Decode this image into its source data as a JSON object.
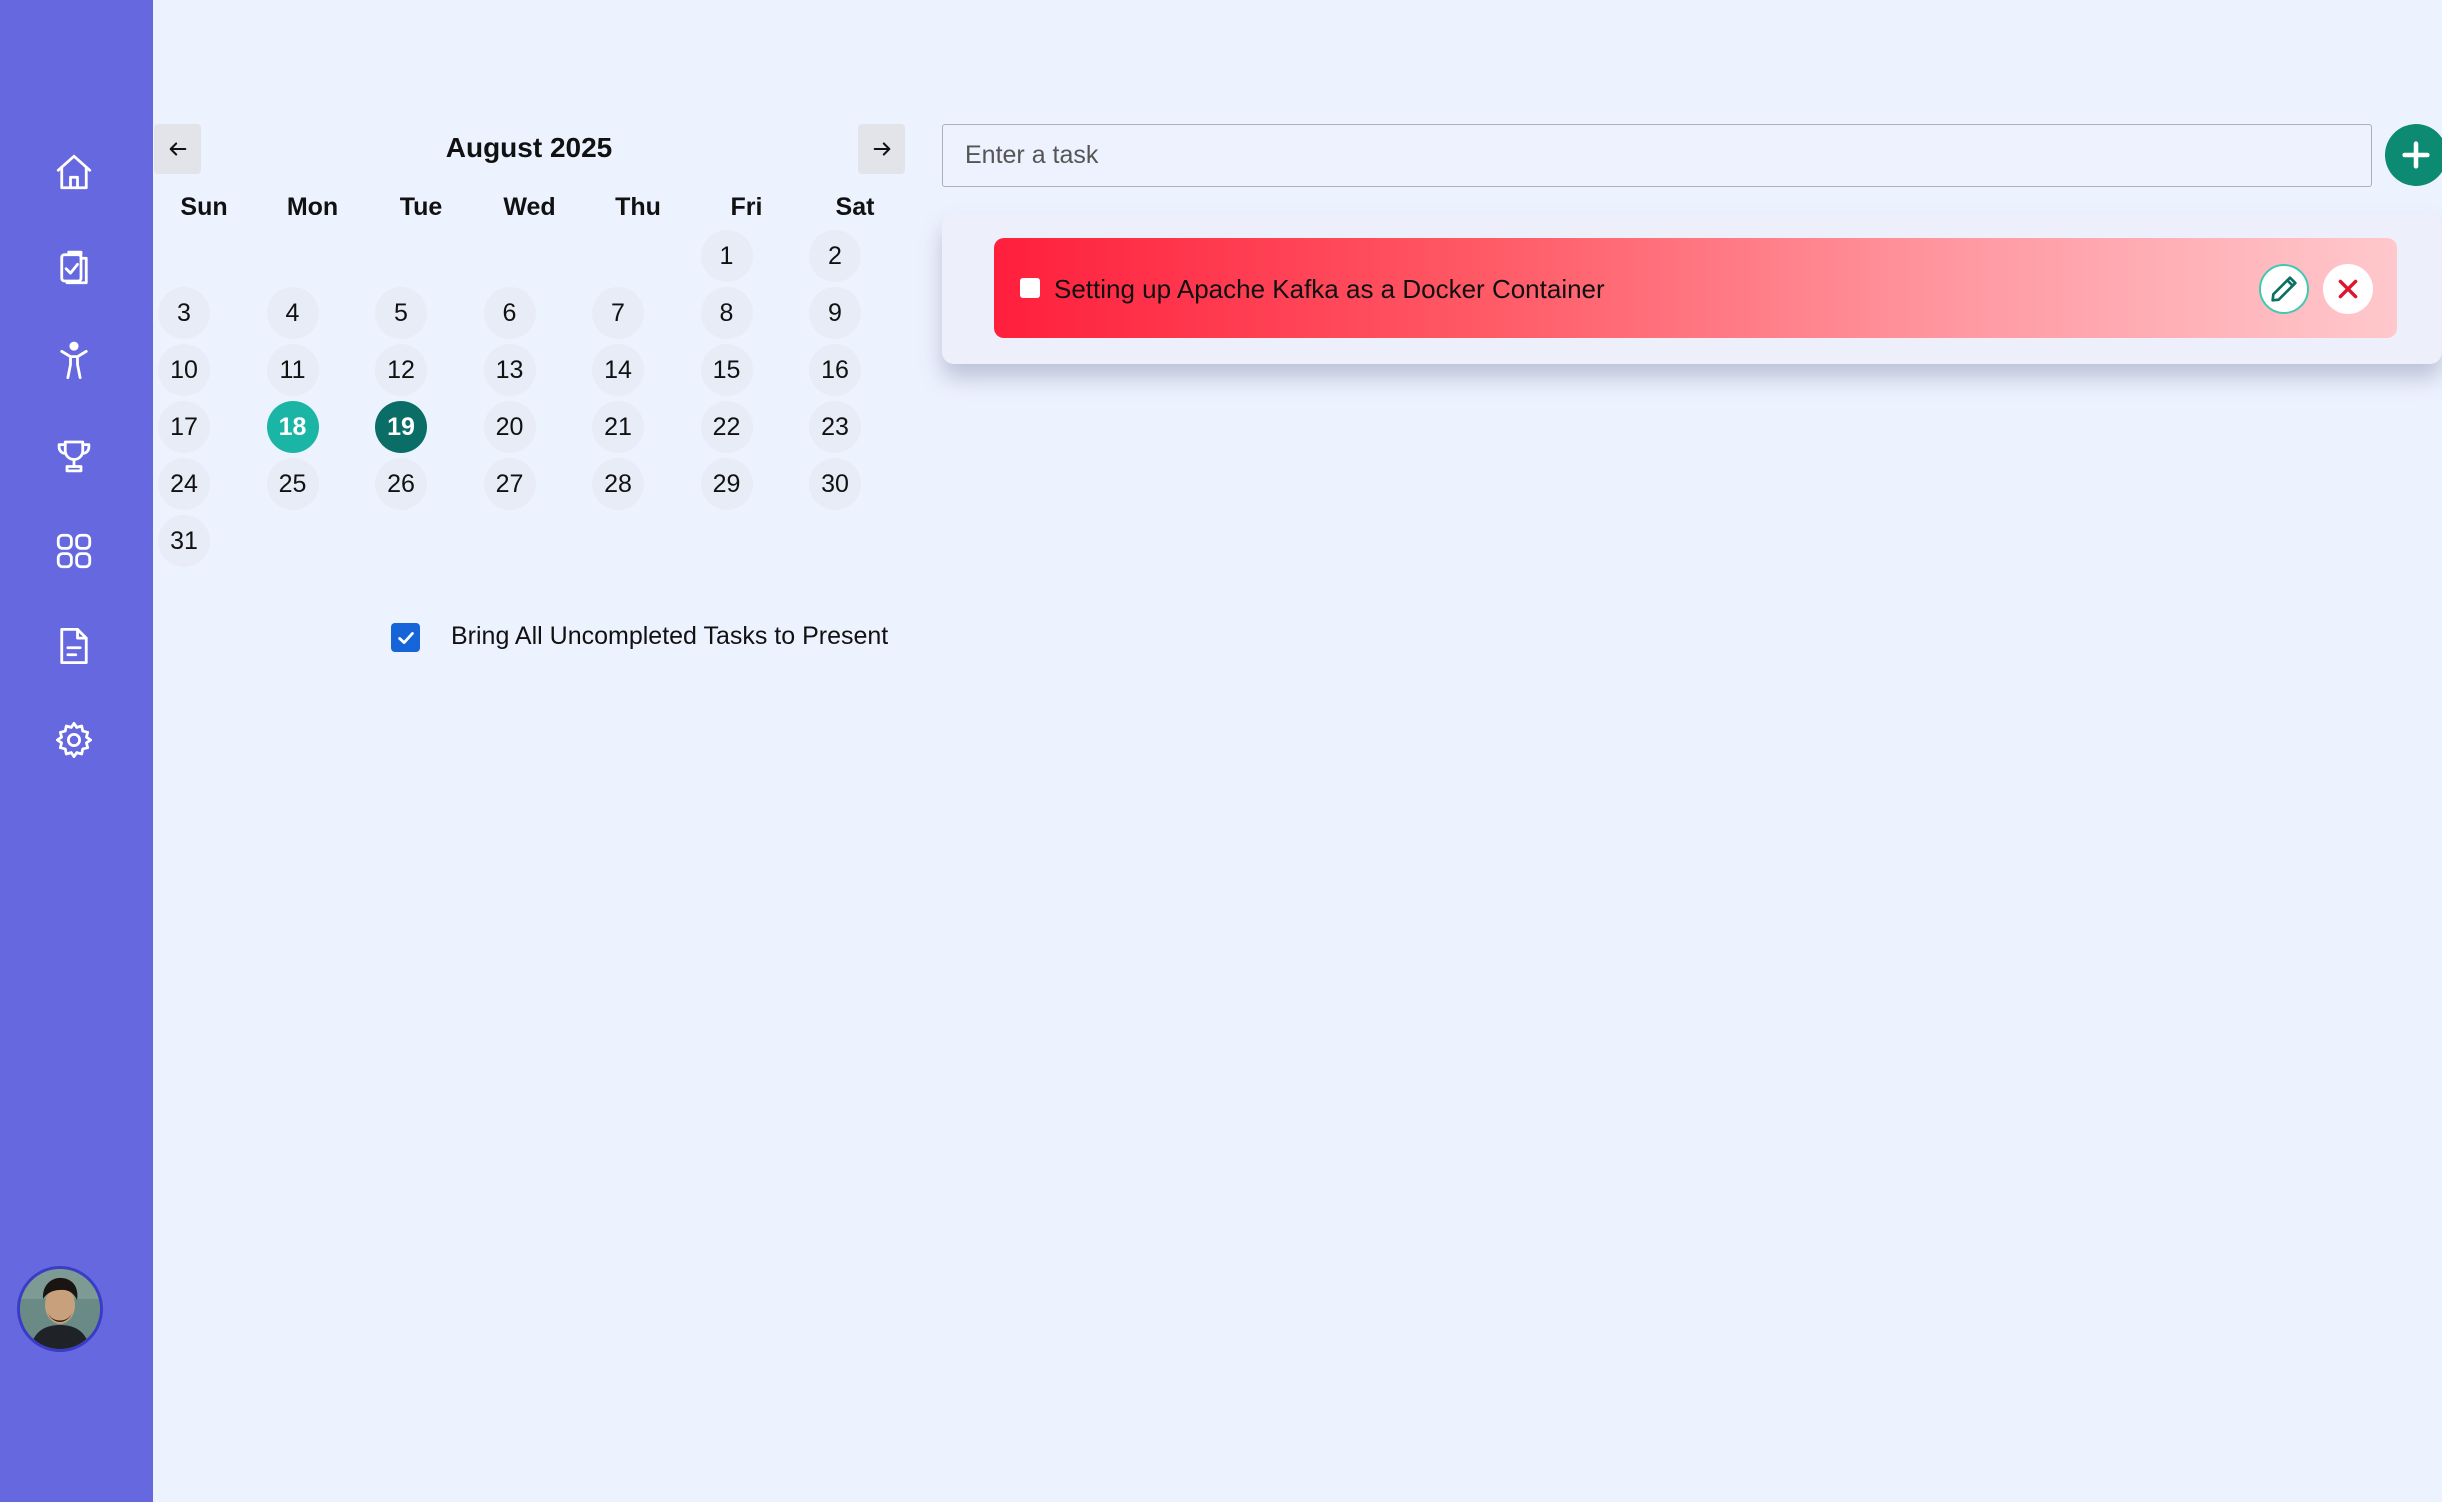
{
  "sidebar": {
    "items": [
      {
        "icon": "home-icon"
      },
      {
        "icon": "clipboard-check-icon"
      },
      {
        "icon": "person-activity-icon"
      },
      {
        "icon": "trophy-icon"
      },
      {
        "icon": "apps-grid-icon"
      },
      {
        "icon": "document-icon"
      },
      {
        "icon": "settings-gear-icon"
      }
    ],
    "avatar": "user-avatar"
  },
  "calendar": {
    "title": "August 2025",
    "prev_icon": "arrow-left-icon",
    "next_icon": "arrow-right-icon",
    "weekdays": [
      "Sun",
      "Mon",
      "Tue",
      "Wed",
      "Thu",
      "Fri",
      "Sat"
    ],
    "first_weekday_index": 5,
    "days_in_month": 31,
    "today": 18,
    "selected": 19
  },
  "options": {
    "bring_uncompleted": {
      "label": "Bring All Uncompleted Tasks to Present",
      "checked": true
    }
  },
  "task_input": {
    "placeholder": "Enter a task",
    "value": ""
  },
  "add_icon": "plus-icon",
  "tasks": [
    {
      "text": "Setting up Apache Kafka as a Docker Container",
      "completed": false,
      "edit_icon": "pencil-icon",
      "delete_icon": "close-icon"
    }
  ],
  "colors": {
    "sidebar": "#6668e0",
    "background": "#edf2ff",
    "today": "#1bb5a6",
    "selected": "#0b6e66",
    "accent": "#0d8a72",
    "task_high_priority": "#ff1f3d"
  }
}
